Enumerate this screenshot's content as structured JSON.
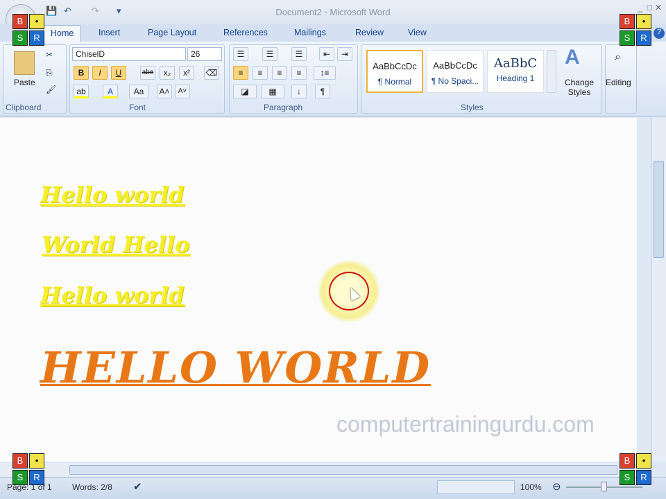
{
  "window": {
    "title": "Document2 - Microsoft Word",
    "controls": [
      "_",
      "□",
      "✕"
    ]
  },
  "qat": {
    "save": "💾",
    "undo": "↶",
    "redo": "↷",
    "customize": "▾"
  },
  "tabs": [
    "Home",
    "Insert",
    "Page Layout",
    "References",
    "Mailings",
    "Review",
    "View"
  ],
  "ribbon": {
    "clipboard": {
      "label": "Clipboard",
      "paste": "Paste"
    },
    "font": {
      "label": "Font",
      "name": "ChiselD",
      "size": "26",
      "bold": "B",
      "italic": "I",
      "underline": "U",
      "strike": "abe",
      "sub": "x₂",
      "sup": "x²",
      "grow": "A˄",
      "shrink": "A˅",
      "case": "Aa"
    },
    "paragraph": {
      "label": "Paragraph",
      "pilcrow": "¶"
    },
    "styles": {
      "label": "Styles",
      "items": [
        {
          "preview": "AaBbCcDc",
          "name": "¶ Normal"
        },
        {
          "preview": "AaBbCcDc",
          "name": "¶ No Spaci..."
        },
        {
          "preview": "AaBbC",
          "name": "Heading 1"
        }
      ],
      "change": "Change Styles"
    },
    "editing": {
      "label": "Editing"
    }
  },
  "document": {
    "lines": [
      "Hello world",
      "World Hello",
      "Hello world"
    ],
    "heading": "HELLO WORLD",
    "watermark": "computertrainingurdu.com"
  },
  "status": {
    "page": "Page: 1 of 1",
    "words": "Words: 2/8",
    "zoom": "100%"
  },
  "logo": {
    "b": "B",
    "s": "S",
    "r": "R",
    "y": "•"
  },
  "colors": {
    "yellow_text": "#f5ef2a",
    "orange_text": "#e87817",
    "selected": "#fbd67e"
  }
}
